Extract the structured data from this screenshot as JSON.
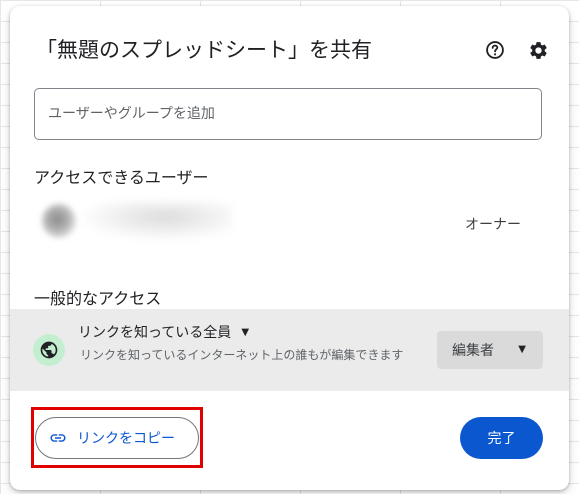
{
  "dialog": {
    "title": "「無題のスプレッドシート」を共有",
    "help_icon": "help-circle-icon",
    "settings_icon": "gear-icon"
  },
  "add_people": {
    "placeholder": "ユーザーやグループを追加",
    "value": ""
  },
  "people_with_access": {
    "heading": "アクセスできるユーザー",
    "users": [
      {
        "role": "オーナー"
      }
    ]
  },
  "general_access": {
    "heading": "一般的なアクセス",
    "icon": "globe-icon",
    "scope": "リンクを知っている全員",
    "description": "リンクを知っているインターネット上の誰もが編集できます",
    "role": "編集者"
  },
  "footer": {
    "copy_link_label": "リンクをコピー",
    "copy_link_icon": "link-icon",
    "done_label": "完了"
  },
  "colors": {
    "accent": "#0b57d0",
    "highlight_border": "#e00000",
    "globe_badge": "#c4eed0",
    "general_access_bg": "#ebebeb"
  }
}
